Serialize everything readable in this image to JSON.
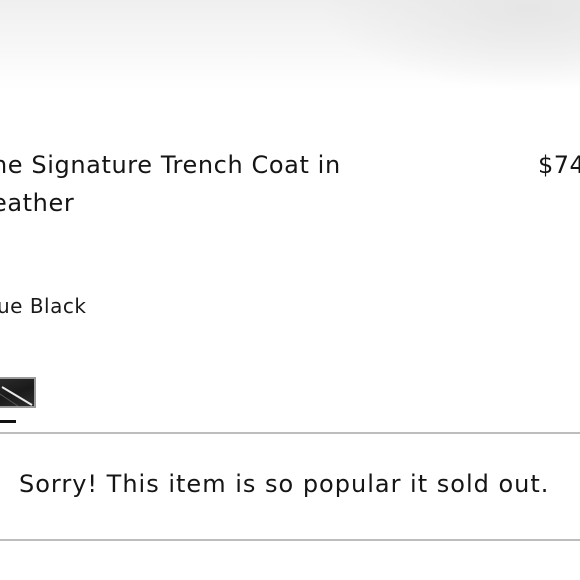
{
  "product": {
    "title": "he Signature Trench Coat in eather",
    "price": "$74",
    "color_name": "ue Black"
  },
  "colors": {
    "selected_swatch": "#1e1e1e",
    "divider": "#bdbdbd"
  },
  "availability": {
    "message": "Sorry! This item is so popular it sold out."
  }
}
